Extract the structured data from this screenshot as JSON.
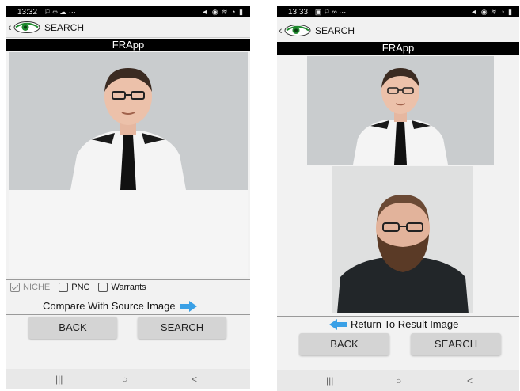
{
  "left_phone": {
    "status_time": "13:32",
    "status_icons_left": "⚐ ∞ ☁ ···",
    "status_icons_right": "◄ ◉ ≋ ◔ ▮",
    "header_title": "SEARCH",
    "app_title": "FRApp",
    "filters": [
      {
        "label": "NICHE",
        "checked": true
      },
      {
        "label": "PNC",
        "checked": false
      },
      {
        "label": "Warrants",
        "checked": false
      }
    ],
    "compare_label": "Compare With Source Image",
    "back_label": "BACK",
    "search_label": "SEARCH",
    "nav": {
      "recents": "|||",
      "home": "○",
      "back": "<"
    }
  },
  "right_phone": {
    "status_time": "13:33",
    "status_icons_left": "▣ ⚐ ∞ ···",
    "status_icons_right": "◄ ◉ ≋ ◔ ▮",
    "header_title": "SEARCH",
    "app_title": "FRApp",
    "return_label": "Return To Result Image",
    "back_label": "BACK",
    "search_label": "SEARCH",
    "nav": {
      "recents": "|||",
      "home": "○",
      "back": "<"
    }
  },
  "colors": {
    "accent_arrow": "#3aa0e6",
    "logo_green": "#1f8a2e",
    "appbar": "#000000"
  }
}
